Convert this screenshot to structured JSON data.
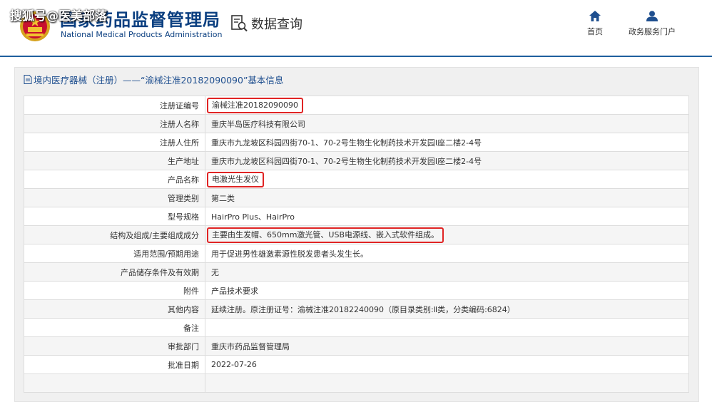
{
  "watermark": "搜狐号@医美部落",
  "header": {
    "agency_cn": "国家药品监督管理局",
    "agency_en": "National Medical Products Administration",
    "search_label": "数据查询",
    "nav_home": "首页",
    "nav_portal": "政务服务门户"
  },
  "panel": {
    "title": "境内医疗器械（注册）——“渝械注准20182090090”基本信息"
  },
  "rows": [
    {
      "key": "注册证编号",
      "value": "渝械注准20182090090"
    },
    {
      "key": "注册人名称",
      "value": "重庆半岛医疗科技有限公司"
    },
    {
      "key": "注册人住所",
      "value": "重庆市九龙坡区科园四街70-1、70-2号生物生化制药技术开发园Ⅰ座二楼2-4号"
    },
    {
      "key": "生产地址",
      "value": "重庆市九龙坡区科园四街70-1、70-2号生物生化制药技术开发园Ⅰ座二楼2-4号"
    },
    {
      "key": "产品名称",
      "value": "电激光生发仪"
    },
    {
      "key": "管理类别",
      "value": "第二类"
    },
    {
      "key": "型号规格",
      "value": "HairPro Plus、HairPro"
    },
    {
      "key": "结构及组成/主要组成成分",
      "value": "主要由生发帽、650mm激光管、USB电源线、嵌入式软件组成。"
    },
    {
      "key": "适用范围/预期用途",
      "value": "用于促进男性雄激素源性脱发患者头发生长。"
    },
    {
      "key": "产品储存条件及有效期",
      "value": "无"
    },
    {
      "key": "附件",
      "value": "产品技术要求"
    },
    {
      "key": "其他内容",
      "value": "延续注册。原注册证号：渝械注准20182240090（原目录类别:Ⅱ类，分类编码:6824）"
    },
    {
      "key": "备注",
      "value": ""
    },
    {
      "key": "审批部门",
      "value": "重庆市药品监督管理局"
    },
    {
      "key": "批准日期",
      "value": "2022-07-26"
    },
    {
      "key": "",
      "value": ""
    }
  ],
  "colors": {
    "brand_blue": "#0b3f80",
    "highlight_red": "#e02424"
  }
}
